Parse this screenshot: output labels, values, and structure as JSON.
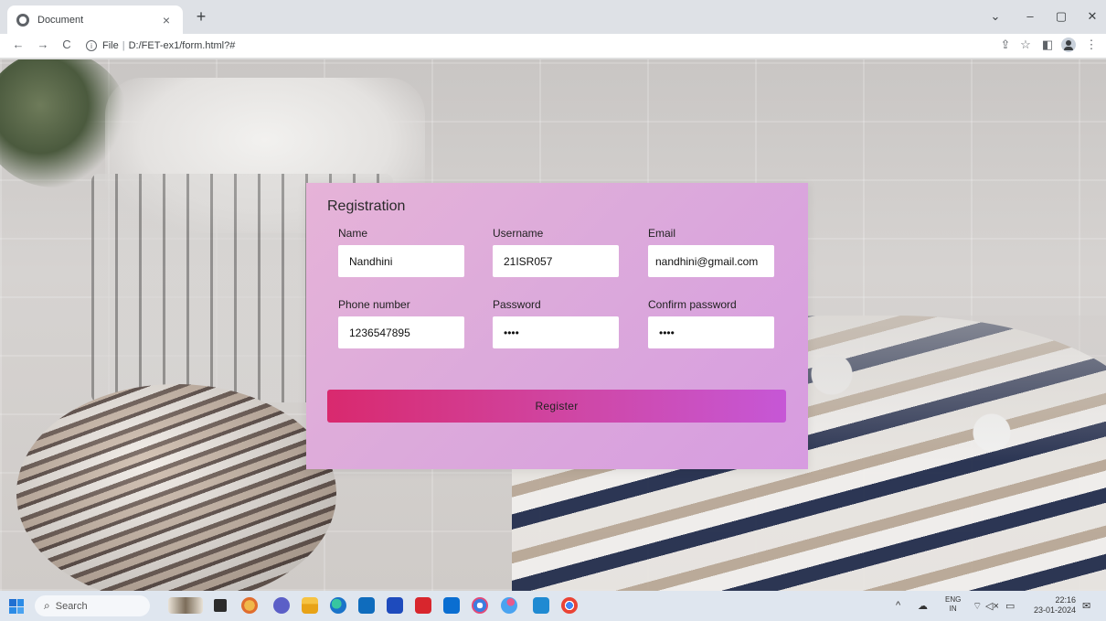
{
  "browser": {
    "tab_title": "Document",
    "tab_close": "×",
    "new_tab": "+",
    "window_controls": {
      "tab_search": "⌄",
      "minimize": "–",
      "restore": "▢",
      "close": "✕"
    },
    "nav": {
      "back": "←",
      "forward": "→",
      "reload": "C"
    },
    "omnibox": {
      "info_glyph": "i",
      "chip": "File",
      "separator": "|",
      "url": "D:/FET-ex1/form.html?#"
    },
    "toolbar_icons": {
      "share": "⇪",
      "bookmark": "☆",
      "side_panel": "◧",
      "menu": "⋮"
    }
  },
  "form": {
    "title": "Registration",
    "fields": [
      {
        "label": "Name",
        "value": "Nandhini"
      },
      {
        "label": "Username",
        "value": "21ISR057"
      },
      {
        "label": "Email",
        "value": "nandhini@gmail.com"
      },
      {
        "label": "Phone number",
        "value": "1236547895"
      },
      {
        "label": "Password",
        "value": "••••"
      },
      {
        "label": "Confirm password",
        "value": "••••"
      }
    ],
    "submit_label": "Register"
  },
  "taskbar": {
    "search_label": "Search",
    "search_glyph": "⌕",
    "apps": [
      "widgets-icon",
      "task-view-icon",
      "copilot-icon",
      "meet-icon",
      "file-explorer-icon",
      "edge-icon",
      "store-icon",
      "app-l-icon",
      "mcafee-icon",
      "outlook-icon",
      "photos-icon",
      "paint-icon",
      "vscode-icon",
      "chrome-icon"
    ],
    "tray": {
      "chevron": "^",
      "onedrive": "☁",
      "wifi": "⌔",
      "volume": "◁×",
      "battery": "▭",
      "notification": "✉"
    },
    "language": {
      "line1": "ENG",
      "line2": "IN"
    },
    "clock": {
      "time": "22:16",
      "date": "23-01-2024"
    }
  },
  "colors": {
    "card_start": "#e6b3d8",
    "card_end": "#d79ce0",
    "button_start": "#d9296e",
    "button_end": "#c657d6"
  }
}
